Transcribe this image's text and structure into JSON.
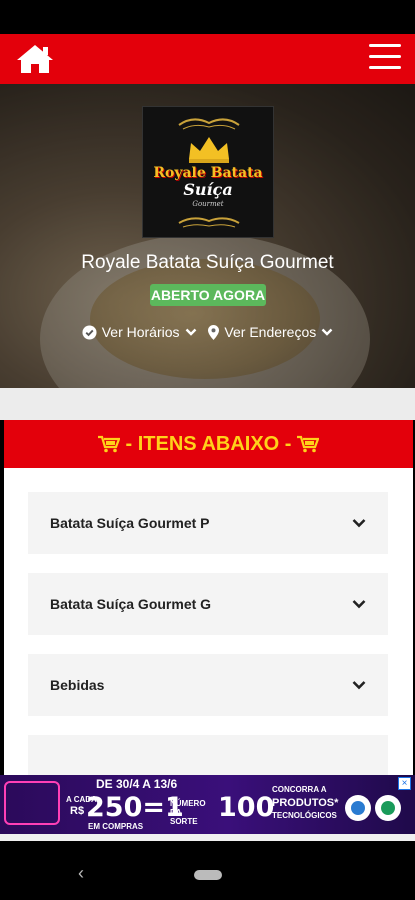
{
  "store": {
    "name": "Royale Batata Suíça Gourmet",
    "status": "ABERTO AGORA",
    "hours_link": "Ver Horários",
    "address_link": "Ver Endereços",
    "logo_text": {
      "line1": "Royale Batata",
      "line2": "Suíça",
      "line3": "Gourmet"
    }
  },
  "section": {
    "header": "- ITENS ABAIXO -"
  },
  "categories": [
    {
      "label": "Batata Suíça Gourmet P"
    },
    {
      "label": "Batata Suíça Gourmet G"
    },
    {
      "label": "Bebidas"
    }
  ],
  "ad": {
    "dates": "DE 30/4 A 13/6",
    "formula": "250=1",
    "prize_count": "100",
    "left_text": "A CADA",
    "currency": "R$",
    "purchase_note": "EM COMPRAS",
    "lucky_number": "NÚMERO DA SORTE",
    "prize_lead": "CONCORRA A",
    "prize_name": "PRODUTOS*",
    "prize_desc": "TECNOLÓGICOS"
  },
  "colors": {
    "brand_red": "#e3000b",
    "badge_green": "#5cb85c",
    "row_bg": "#f4f4f4"
  },
  "icons": {
    "home": "home-icon",
    "menu": "hamburger-menu-icon",
    "cart": "cart-icon",
    "clock": "check-circle-icon",
    "location": "map-pin-icon",
    "chevron": "chevron-down-icon"
  }
}
